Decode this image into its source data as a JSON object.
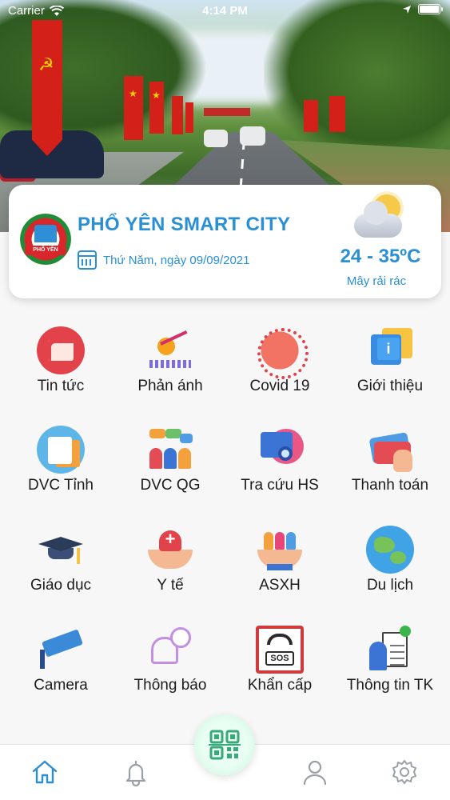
{
  "status_bar": {
    "carrier": "Carrier",
    "time": "4:14 PM"
  },
  "header_card": {
    "logo_text": "PHỔ YÊN",
    "title": "PHỔ YÊN SMART CITY",
    "date": "Thứ Năm, ngày 09/09/2021",
    "weather": {
      "temperature": "24 - 35ºC",
      "description": "Mây rải rác",
      "icon": "partly-cloudy-icon"
    }
  },
  "services": [
    {
      "label": "Tin tức",
      "icon": "news-icon"
    },
    {
      "label": "Phản ánh",
      "icon": "feedback-icon"
    },
    {
      "label": "Covid 19",
      "icon": "virus-icon"
    },
    {
      "label": "Giới thiệu",
      "icon": "info-icon"
    },
    {
      "label": "DVC Tỉnh",
      "icon": "provincial-service-icon"
    },
    {
      "label": "DVC QG",
      "icon": "national-service-icon"
    },
    {
      "label": "Tra cứu HS",
      "icon": "document-search-icon"
    },
    {
      "label": "Thanh toán",
      "icon": "payment-card-icon"
    },
    {
      "label": "Giáo dục",
      "icon": "graduation-cap-icon"
    },
    {
      "label": "Y tế",
      "icon": "health-heart-icon"
    },
    {
      "label": "ASXH",
      "icon": "social-security-icon"
    },
    {
      "label": "Du lịch",
      "icon": "globe-travel-icon"
    },
    {
      "label": "Camera",
      "icon": "cctv-camera-icon"
    },
    {
      "label": "Thông báo",
      "icon": "notification-bell-icon"
    },
    {
      "label": "Khẩn cấp",
      "icon": "sos-phone-icon"
    },
    {
      "label": "Thông tin TK",
      "icon": "account-info-icon"
    }
  ],
  "tab_bar": {
    "tabs": [
      {
        "name": "home",
        "icon": "home-icon",
        "active": true
      },
      {
        "name": "notifications",
        "icon": "bell-icon",
        "active": false
      },
      {
        "name": "qr-scan",
        "icon": "qr-code-icon",
        "active": false
      },
      {
        "name": "profile",
        "icon": "user-icon",
        "active": false
      },
      {
        "name": "settings",
        "icon": "gear-icon",
        "active": false
      }
    ]
  },
  "colors": {
    "accent": "#2b8fd3",
    "tab_active": "#2b8fd3",
    "tab_inactive": "#9aa0a6"
  }
}
